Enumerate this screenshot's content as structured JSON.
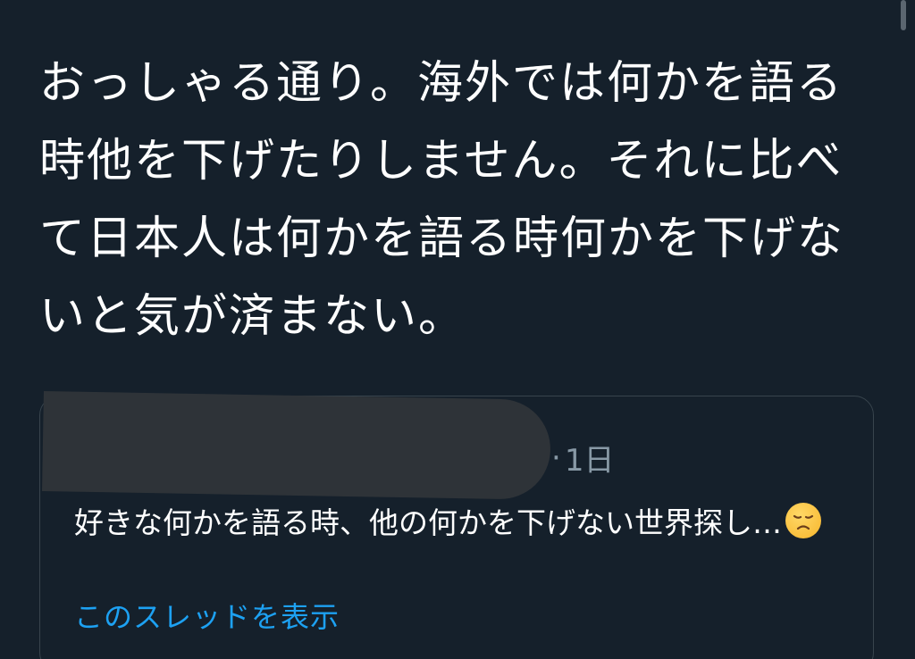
{
  "tweet": {
    "text": "おっしゃる通り。海外では何かを語る時他を下げたりしません。それに比べて日本人は何かを語る時何かを下げないと気が済まない。"
  },
  "quoted_tweet": {
    "separator": "·",
    "time": "1日",
    "text": "好きな何かを語る時、他の何かを下げない世界探し…",
    "emoji": "disappointed-face",
    "show_thread_label": "このスレッドを表示"
  },
  "colors": {
    "background": "#15202b",
    "border": "#38444d",
    "secondary_text": "#8899a6",
    "link": "#1da1f2",
    "redaction": "#2e3338"
  }
}
